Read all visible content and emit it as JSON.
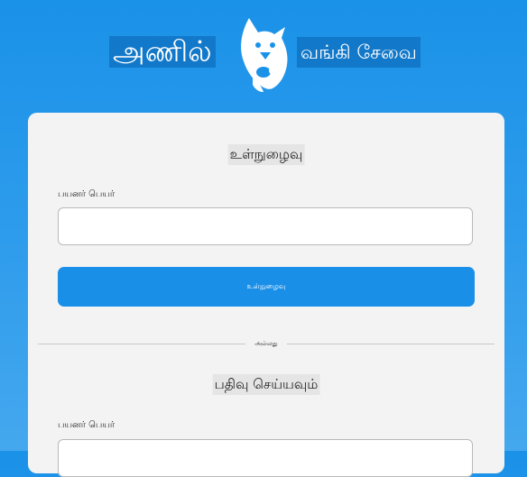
{
  "brand": {
    "name": "அணில்",
    "tagline": "வங்கி சேவை",
    "logo_icon": "squirrel-icon"
  },
  "login": {
    "title": "உள்நுழைவு",
    "username_label": "பயனர் பெயர்",
    "username_value": "",
    "submit_label": "உள்நுழைவு"
  },
  "divider": {
    "text": "அல்லது"
  },
  "register": {
    "title": "பதிவு செய்யவும்",
    "username_label": "பயனர் பெயர்",
    "username_value": ""
  },
  "colors": {
    "background": "#1a92e8",
    "card": "#f3f3f3",
    "button": "#1a8fe8",
    "brand_highlight": "#1278c9"
  }
}
